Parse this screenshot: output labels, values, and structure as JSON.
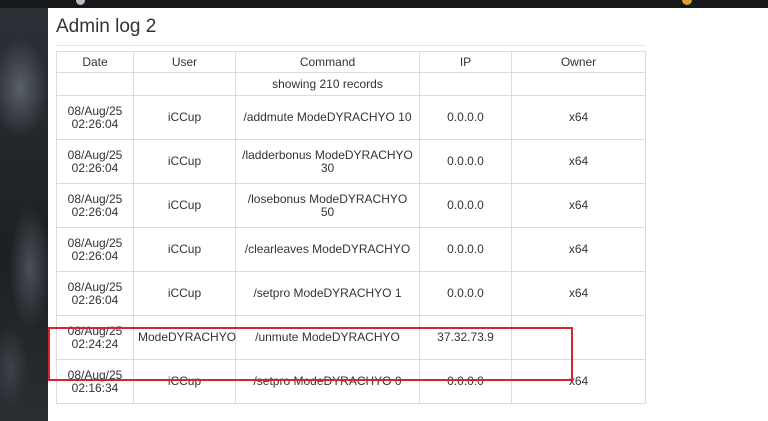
{
  "page": {
    "title": "Admin log 2"
  },
  "table": {
    "columns": [
      "Date",
      "User",
      "Command",
      "IP",
      "Owner"
    ],
    "info": "showing 210 records",
    "rows": [
      {
        "date_line1": "08/Aug/25",
        "date_line2": "02:26:04",
        "user": "iCCup",
        "command": "/addmute ModeDYRACHYO 10",
        "ip": "0.0.0.0",
        "owner": "x64"
      },
      {
        "date_line1": "08/Aug/25",
        "date_line2": "02:26:04",
        "user": "iCCup",
        "command": "/ladderbonus ModeDYRACHYO 30",
        "ip": "0.0.0.0",
        "owner": "x64"
      },
      {
        "date_line1": "08/Aug/25",
        "date_line2": "02:26:04",
        "user": "iCCup",
        "command": "/losebonus ModeDYRACHYO 50",
        "ip": "0.0.0.0",
        "owner": "x64"
      },
      {
        "date_line1": "08/Aug/25",
        "date_line2": "02:26:04",
        "user": "iCCup",
        "command": "/clearleaves ModeDYRACHYO",
        "ip": "0.0.0.0",
        "owner": "x64"
      },
      {
        "date_line1": "08/Aug/25",
        "date_line2": "02:26:04",
        "user": "iCCup",
        "command": "/setpro ModeDYRACHYO 1",
        "ip": "0.0.0.0",
        "owner": "x64"
      },
      {
        "date_line1": "08/Aug/25",
        "date_line2": "02:24:24",
        "user": "ModeDYRACHYO",
        "command": "/unmute ModeDYRACHYO",
        "ip": "37.32.73.9",
        "owner": ""
      },
      {
        "date_line1": "08/Aug/25",
        "date_line2": "02:16:34",
        "user": "iCCup",
        "command": "/setpro ModeDYRACHYO 0",
        "ip": "0.0.0.0",
        "owner": "x64"
      }
    ]
  },
  "colors": {
    "highlight": "#d9232b",
    "border": "#dcdcdc",
    "text": "#333333"
  }
}
